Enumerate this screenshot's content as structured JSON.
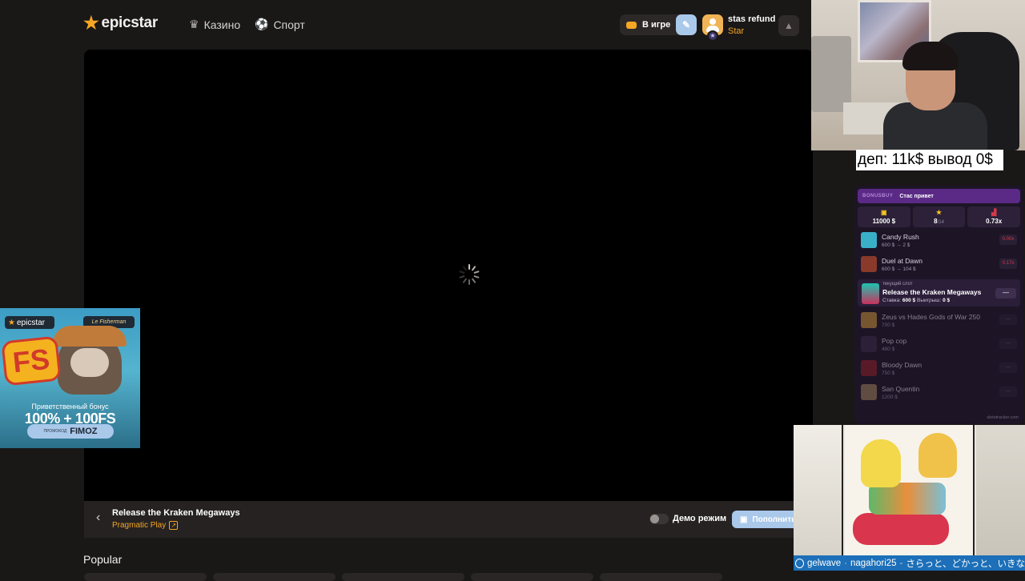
{
  "header": {
    "logo": "epicstar",
    "nav": [
      {
        "label": "Казино",
        "icon": "crown-icon"
      },
      {
        "label": "Спорт",
        "icon": "sport-ball-icon"
      }
    ],
    "in_game_label": "В игре",
    "user": {
      "name": "stas refund",
      "rank": "Star"
    }
  },
  "game": {
    "title": "Release the Kraken Megaways",
    "provider": "Pragmatic Play",
    "demo_label": "Демо режим",
    "topup_label": "Пополнить"
  },
  "section_title": "Popular",
  "overlay": {
    "deposit_text": "деп: 11k$ вывод 0$"
  },
  "tracker": {
    "brand": "BONUSBUY",
    "message": "Стас привет",
    "stats": [
      {
        "icon": "coin-icon",
        "value": "11000 $",
        "sub": ""
      },
      {
        "icon": "star-icon",
        "value": "8",
        "sub": "/14"
      },
      {
        "icon": "chart-icon",
        "value": "0.73x",
        "sub": ""
      }
    ],
    "slots_before": [
      {
        "name": "Candy Rush",
        "sub": "600 $ → 2 $",
        "x": "0.00x",
        "color": "#3ab0c8"
      },
      {
        "name": "Duel at Dawn",
        "sub": "600 $ → 104 $",
        "x": "0.17x",
        "color": "#8a3a2a"
      }
    ],
    "current": {
      "label": "текущий слот",
      "name": "Release the Kraken Megaways",
      "bet_label": "Ставка:",
      "bet": "600 $",
      "win_label": "Выигрыш:",
      "win": "0 $",
      "action": "—"
    },
    "slots_after": [
      {
        "name": "Zeus vs Hades Gods of War 250",
        "sub": "700 $",
        "x": "—",
        "color": "#c08a3a"
      },
      {
        "name": "Pop cop",
        "sub": "480 $",
        "x": "—",
        "color": "#3a2a4a"
      },
      {
        "name": "Bloody Dawn",
        "sub": "750 $",
        "x": "—",
        "color": "#8a1f2a"
      },
      {
        "name": "San Quentin",
        "sub": "1200 $",
        "x": "—",
        "color": "#9a7a5a"
      }
    ],
    "footer": "slotstracker.com"
  },
  "promo": {
    "logo": "epicstar",
    "tag": "Le Fisherman",
    "fs_badge": "FS",
    "line1": "Приветственный бонус",
    "line2": "100% + 100FS",
    "promo_label": "ПРОМОКОД",
    "code": "FIMOZ"
  },
  "chat": {
    "user1": "gelwave",
    "user2": "nagahori25",
    "message2": "さらっと、どかっと、いきな"
  }
}
